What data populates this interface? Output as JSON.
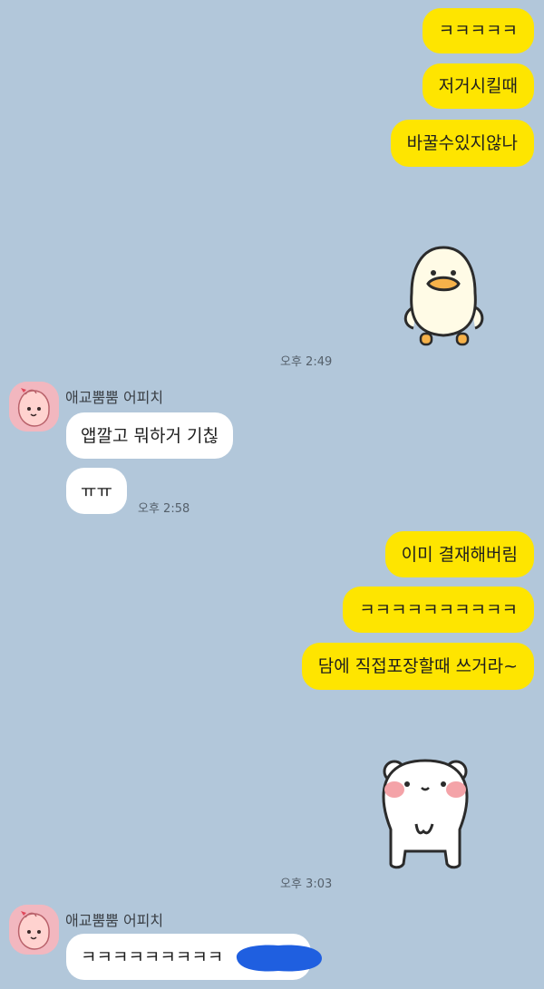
{
  "messages": {
    "m1": "ㅋㅋㅋㅋㅋ",
    "m2": "저거시킬때",
    "m3": "바꿀수있지않나",
    "t1": "오후 2:49",
    "sender1": "애교뿜뿜 어피치",
    "r1": "앱깔고 뭐하거 기칞",
    "r2": "ㅠㅠ",
    "t2": "오후 2:58",
    "m4": "이미 결재해버림",
    "m5": "ㅋㅋㅋㅋㅋㅋㅋㅋㅋㅋ",
    "m6": "담에 직접포장할때 쓰거라~",
    "t3": "오후 3:03",
    "sender2": "애교뿜뿜 어피치",
    "r3": "ㅋㅋㅋㅋㅋㅋㅋㅋㅋ"
  },
  "icons": {
    "duck": "duck-sticker-icon",
    "bear": "bear-sticker-icon",
    "avatar": "apeach-avatar-icon"
  },
  "colors": {
    "background": "#b2c7da",
    "my_bubble": "#fee500",
    "their_bubble": "#ffffff",
    "redaction": "#1f5fe0"
  }
}
